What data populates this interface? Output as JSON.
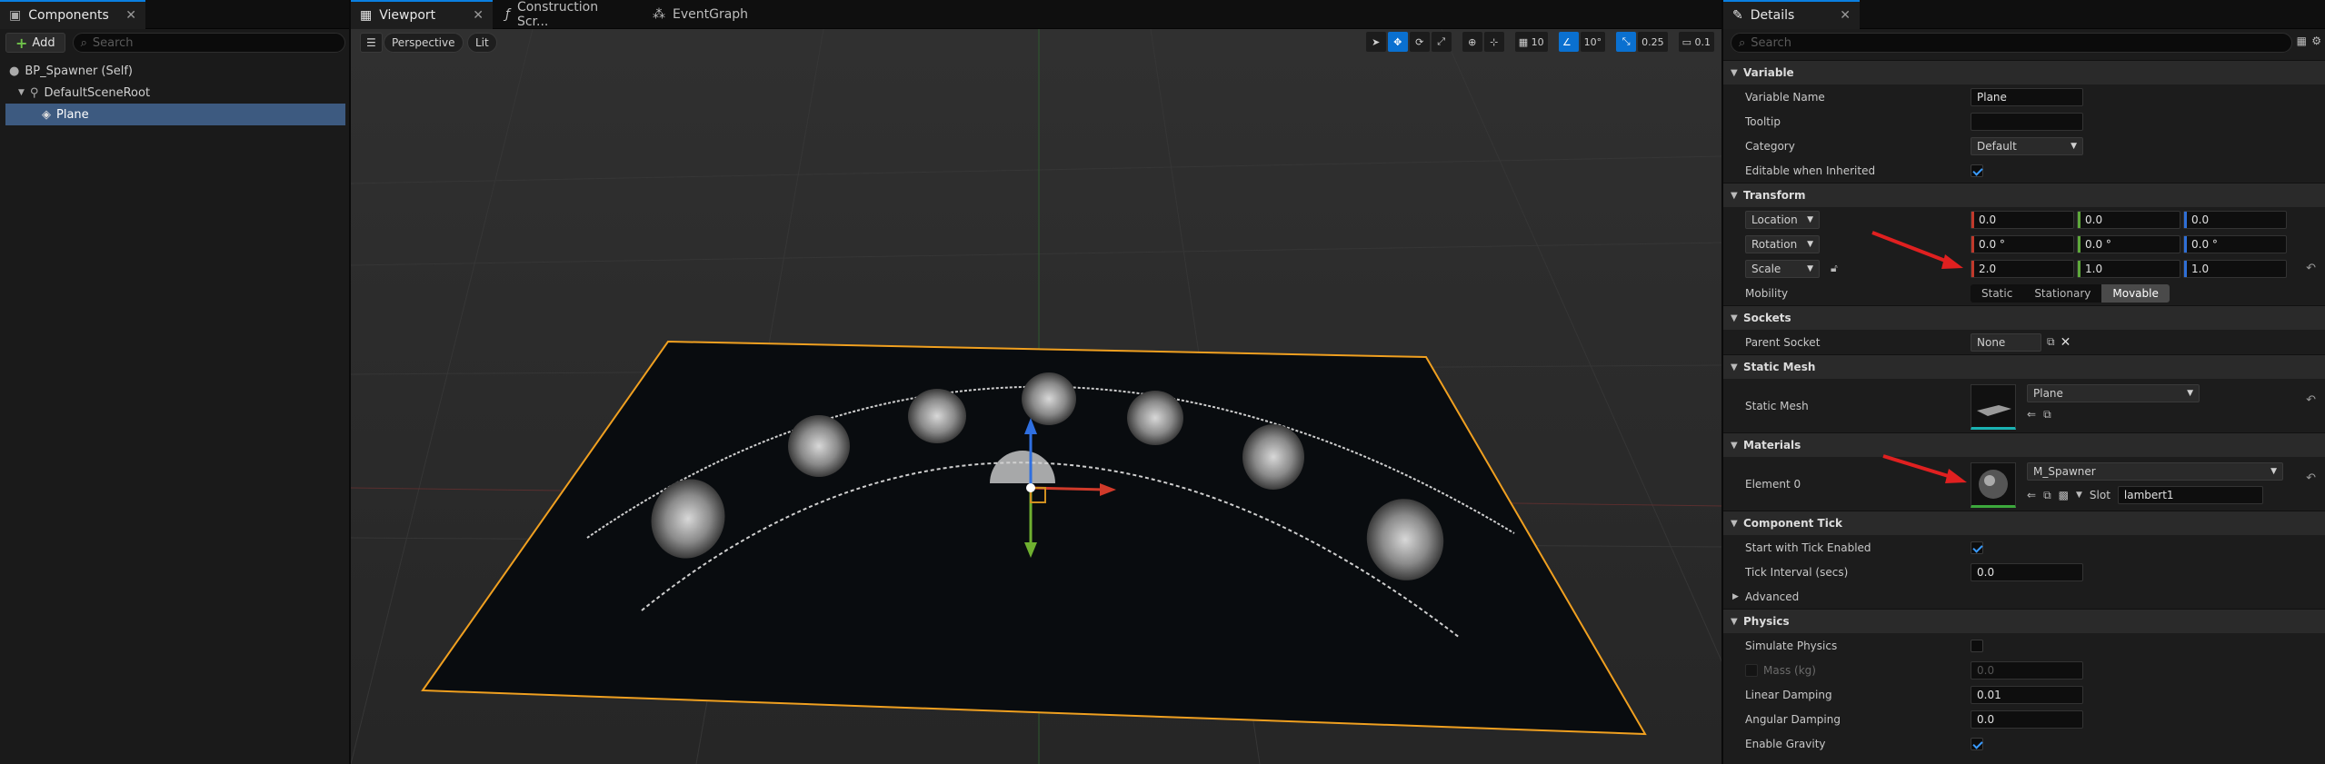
{
  "components": {
    "tab_label": "Components",
    "add_label": "Add",
    "search_placeholder": "Search",
    "tree": [
      {
        "label": "BP_Spawner (Self)",
        "depth": 0,
        "selected": false
      },
      {
        "label": "DefaultSceneRoot",
        "depth": 1,
        "selected": false
      },
      {
        "label": "Plane",
        "depth": 2,
        "selected": true
      }
    ]
  },
  "viewport": {
    "tabs": [
      "Viewport",
      "Construction Scr...",
      "EventGraph"
    ],
    "perspective_label": "Perspective",
    "lit_label": "Lit",
    "grid_snap": "10",
    "rotation_snap": "10°",
    "scale_snap": "0.25",
    "camera_speed": "0.1"
  },
  "details": {
    "tab_label": "Details",
    "search_placeholder": "Search",
    "variable": {
      "header": "Variable",
      "name_label": "Variable Name",
      "name_value": "Plane",
      "tooltip_label": "Tooltip",
      "tooltip_value": "",
      "category_label": "Category",
      "category_value": "Default",
      "editable_label": "Editable when Inherited"
    },
    "transform": {
      "header": "Transform",
      "location_label": "Location",
      "location": [
        "0.0",
        "0.0",
        "0.0"
      ],
      "rotation_label": "Rotation",
      "rotation": [
        "0.0 °",
        "0.0 °",
        "0.0 °"
      ],
      "scale_label": "Scale",
      "scale": [
        "2.0",
        "1.0",
        "1.0"
      ],
      "mobility_label": "Mobility",
      "mobility_options": [
        "Static",
        "Stationary",
        "Movable"
      ]
    },
    "sockets": {
      "header": "Sockets",
      "parent_label": "Parent Socket",
      "parent_value": "None"
    },
    "static_mesh": {
      "header": "Static Mesh",
      "label": "Static Mesh",
      "value": "Plane"
    },
    "materials": {
      "header": "Materials",
      "element_label": "Element 0",
      "value": "M_Spawner",
      "slot_label": "Slot",
      "slot_value": "lambert1"
    },
    "component_tick": {
      "header": "Component Tick",
      "start_label": "Start with Tick Enabled",
      "interval_label": "Tick Interval (secs)",
      "interval_value": "0.0",
      "advanced_label": "Advanced"
    },
    "physics": {
      "header": "Physics",
      "simulate_label": "Simulate Physics",
      "mass_label": "Mass (kg)",
      "mass_value": "0.0",
      "linear_label": "Linear Damping",
      "linear_value": "0.01",
      "angular_label": "Angular Damping",
      "angular_value": "0.0",
      "gravity_label": "Enable Gravity"
    }
  },
  "colors": {
    "accent": "#0a70d0",
    "selection_outline": "#f0a020",
    "annotation_arrow": "#e02020"
  }
}
